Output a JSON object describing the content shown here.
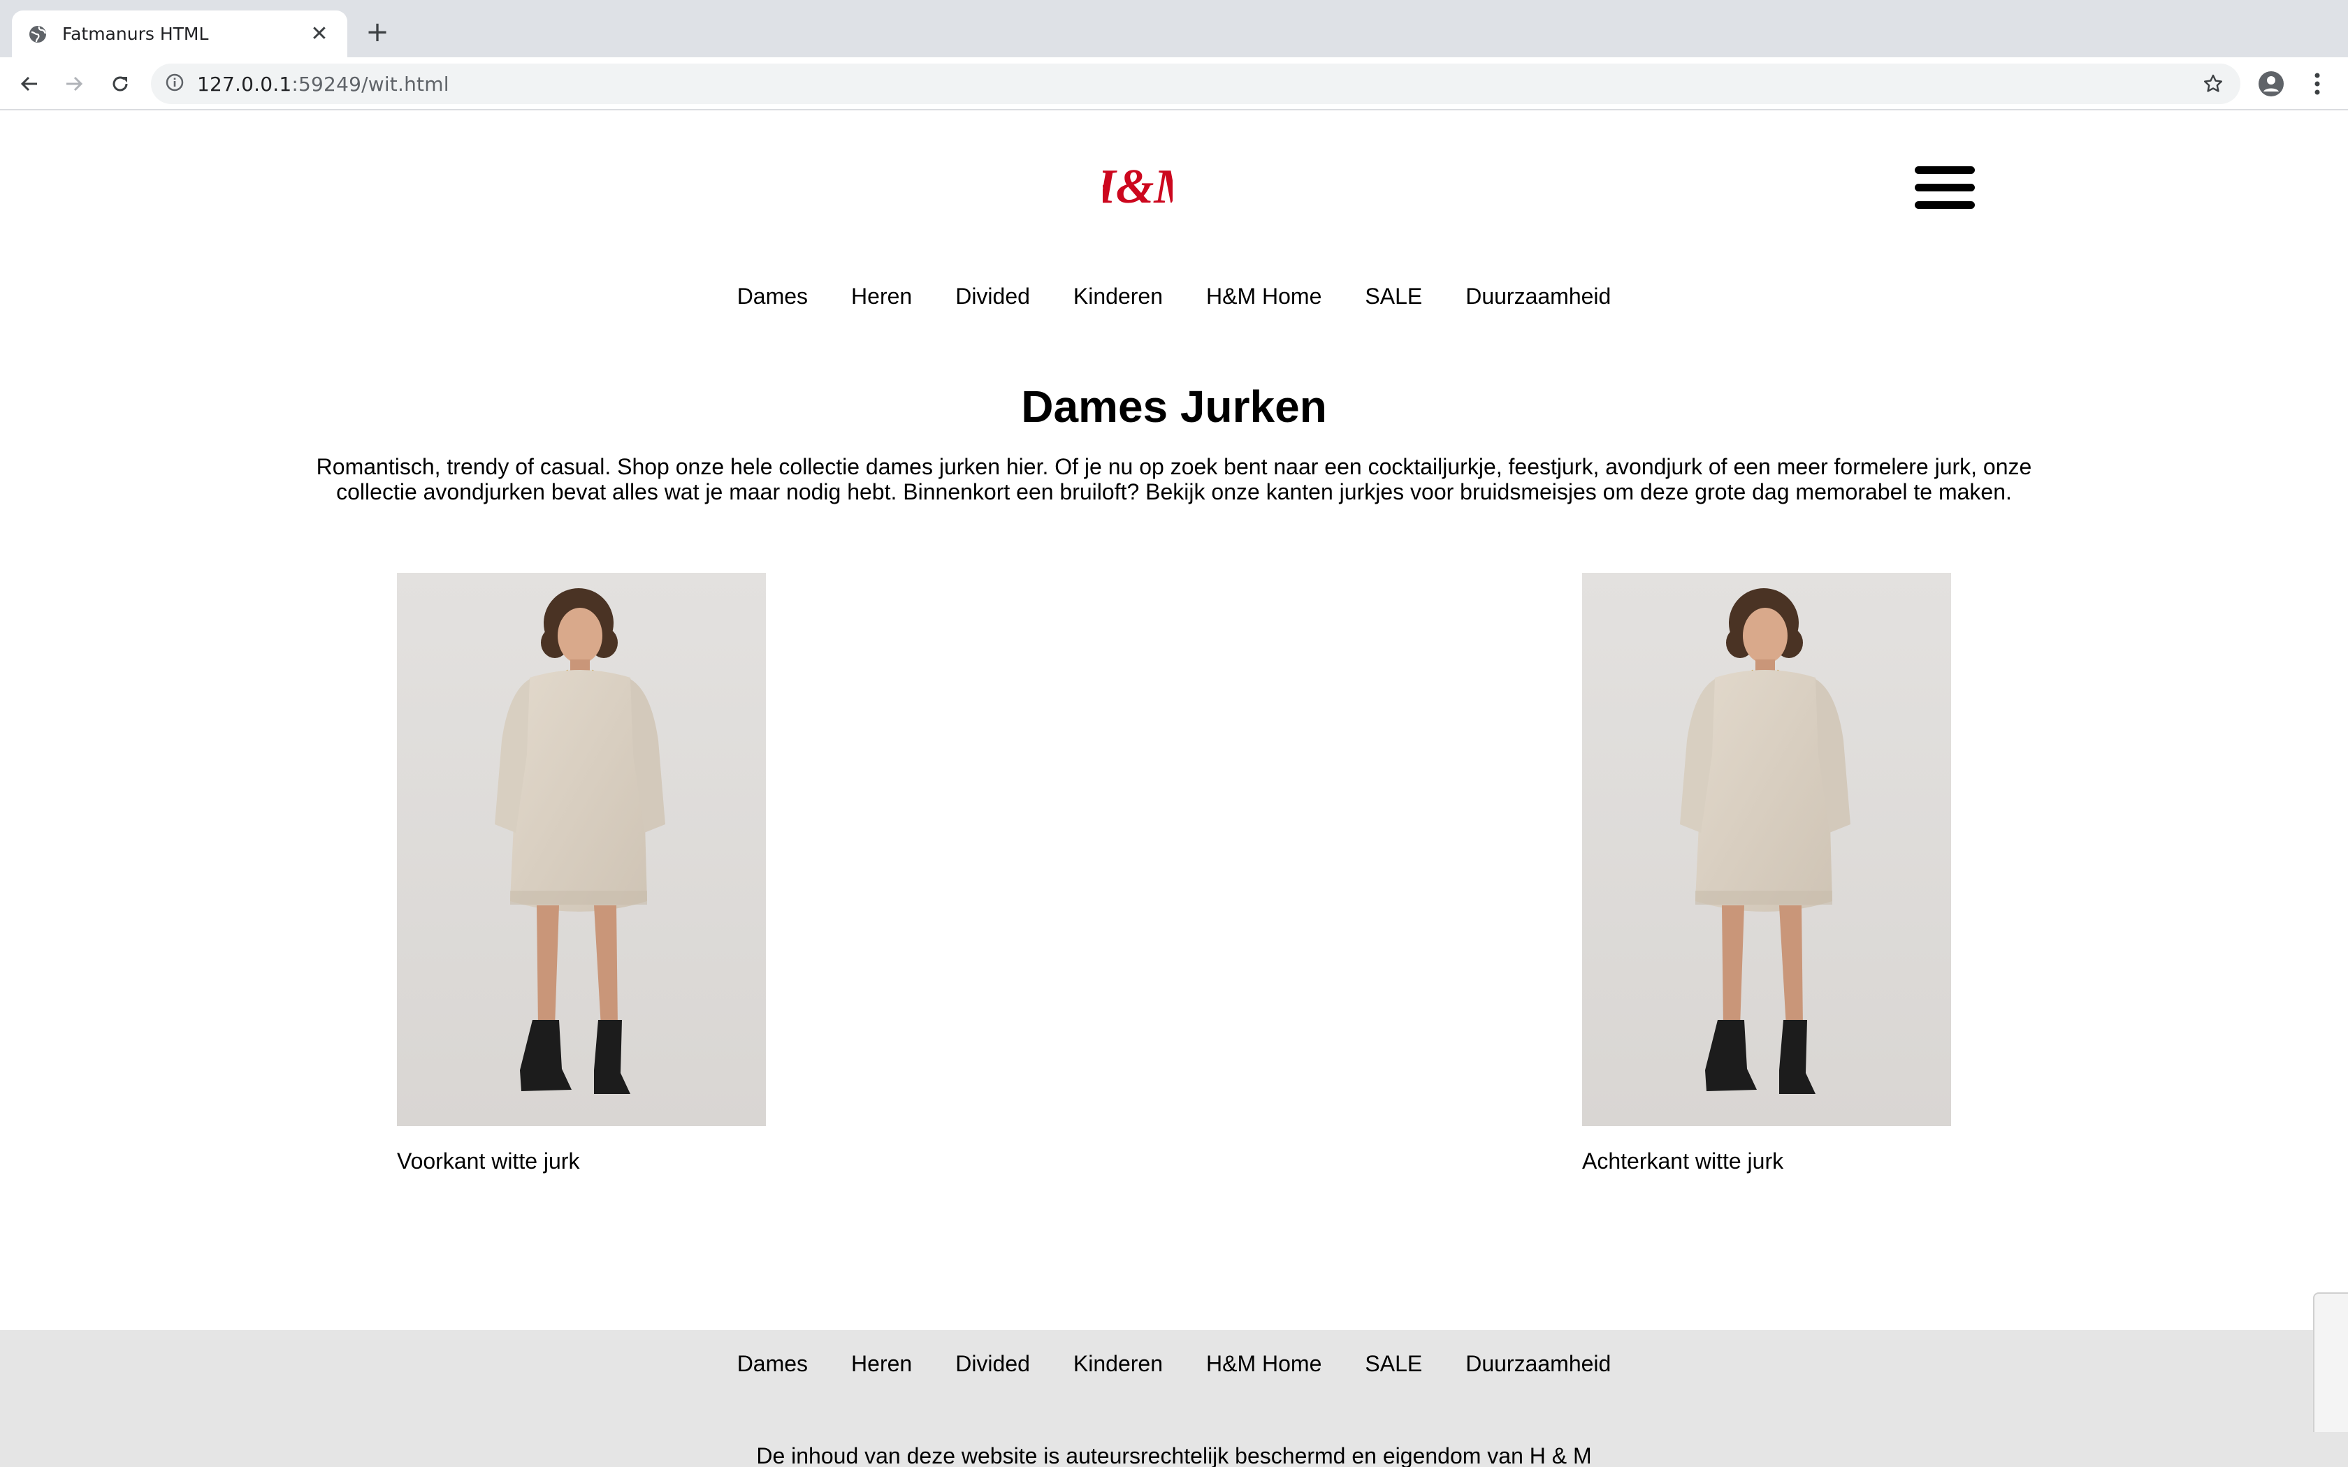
{
  "browser": {
    "tab_title": "Fatmanurs HTML",
    "tab_close": "✕",
    "new_tab": "+",
    "url_host": "127.0.0.1",
    "url_rest": ":59249/wit.html"
  },
  "header": {
    "logo_text": "H&M",
    "logo_color": "#cc071e"
  },
  "nav": {
    "items": [
      "Dames",
      "Heren",
      "Divided",
      "Kinderen",
      "H&M Home",
      "SALE",
      "Duurzaamheid"
    ]
  },
  "main": {
    "title": "Dames Jurken",
    "intro": "Romantisch, trendy of casual. Shop onze hele collectie dames jurken hier. Of je nu op zoek bent naar een cocktailjurkje, feestjurk, avondjurk of een meer formelere jurk, onze collectie avondjurken bevat alles wat je maar nodig hebt. Binnenkort een bruiloft? Bekijk onze kanten jurkjes voor bruidsmeisjes om deze grote dag memorabel te maken.",
    "products": [
      {
        "caption": "Voorkant witte jurk"
      },
      {
        "caption": "Achterkant witte jurk"
      }
    ]
  },
  "footer": {
    "nav_items": [
      "Dames",
      "Heren",
      "Divided",
      "Kinderen",
      "H&M Home",
      "SALE",
      "Duurzaamheid"
    ],
    "copyright": "De inhoud van deze website is auteursrechtelijk beschermd en eigendom van H & M"
  }
}
